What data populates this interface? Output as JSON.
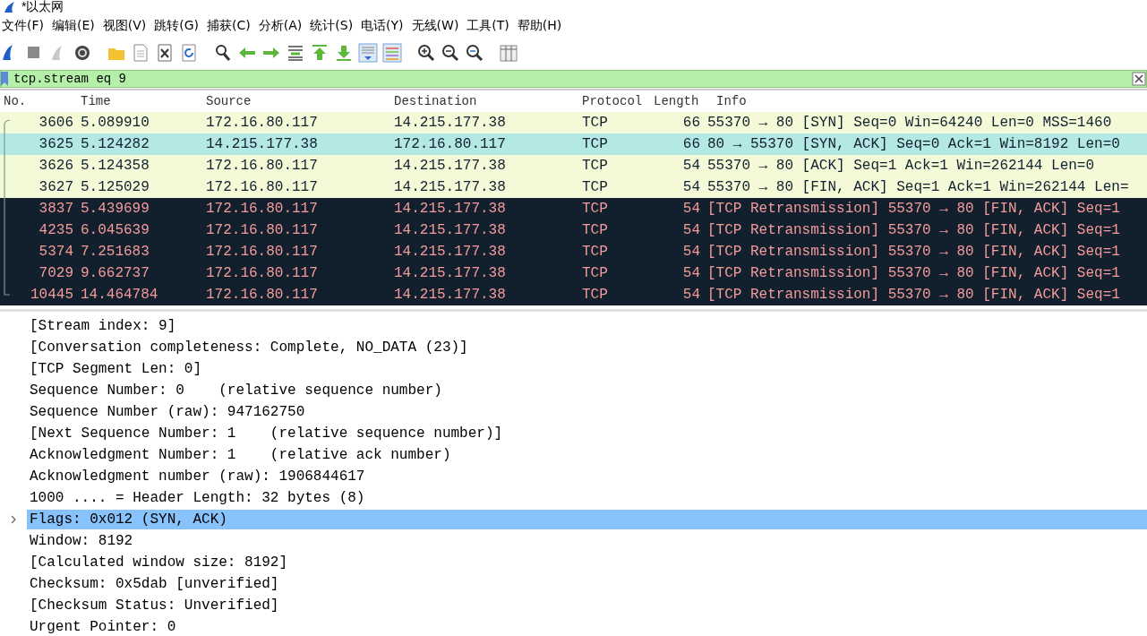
{
  "window": {
    "title": "*以太网"
  },
  "menu": [
    "文件(F)",
    "编辑(E)",
    "视图(V)",
    "跳转(G)",
    "捕获(C)",
    "分析(A)",
    "统计(S)",
    "电话(Y)",
    "无线(W)",
    "工具(T)",
    "帮助(H)"
  ],
  "filter": {
    "value": "tcp.stream eq 9"
  },
  "packet_list": {
    "columns": [
      "No.",
      "Time",
      "Source",
      "Destination",
      "Protocol",
      "Length",
      "Info"
    ],
    "rows": [
      {
        "no": "3606",
        "time": "5.089910",
        "source": "172.16.80.117",
        "destination": "14.215.177.38",
        "protocol": "TCP",
        "length": "66",
        "info": "55370 → 80 [SYN] Seq=0 Win=64240 Len=0 MSS=1460",
        "kind": "normal",
        "selected": false
      },
      {
        "no": "3625",
        "time": "5.124282",
        "source": "14.215.177.38",
        "destination": "172.16.80.117",
        "protocol": "TCP",
        "length": "66",
        "info": "80 → 55370 [SYN, ACK] Seq=0 Ack=1 Win=8192 Len=0",
        "kind": "normal",
        "selected": true
      },
      {
        "no": "3626",
        "time": "5.124358",
        "source": "172.16.80.117",
        "destination": "14.215.177.38",
        "protocol": "TCP",
        "length": "54",
        "info": "55370 → 80 [ACK] Seq=1 Ack=1 Win=262144 Len=0",
        "kind": "normal",
        "selected": false
      },
      {
        "no": "3627",
        "time": "5.125029",
        "source": "172.16.80.117",
        "destination": "14.215.177.38",
        "protocol": "TCP",
        "length": "54",
        "info": "55370 → 80 [FIN, ACK] Seq=1 Ack=1 Win=262144 Len=",
        "kind": "normal",
        "selected": false
      },
      {
        "no": "3837",
        "time": "5.439699",
        "source": "172.16.80.117",
        "destination": "14.215.177.38",
        "protocol": "TCP",
        "length": "54",
        "info": "[TCP Retransmission] 55370 → 80 [FIN, ACK] Seq=1",
        "kind": "bad",
        "selected": false
      },
      {
        "no": "4235",
        "time": "6.045639",
        "source": "172.16.80.117",
        "destination": "14.215.177.38",
        "protocol": "TCP",
        "length": "54",
        "info": "[TCP Retransmission] 55370 → 80 [FIN, ACK] Seq=1",
        "kind": "bad",
        "selected": false
      },
      {
        "no": "5374",
        "time": "7.251683",
        "source": "172.16.80.117",
        "destination": "14.215.177.38",
        "protocol": "TCP",
        "length": "54",
        "info": "[TCP Retransmission] 55370 → 80 [FIN, ACK] Seq=1",
        "kind": "bad",
        "selected": false
      },
      {
        "no": "7029",
        "time": "9.662737",
        "source": "172.16.80.117",
        "destination": "14.215.177.38",
        "protocol": "TCP",
        "length": "54",
        "info": "[TCP Retransmission] 55370 → 80 [FIN, ACK] Seq=1",
        "kind": "bad",
        "selected": false
      },
      {
        "no": "10445",
        "time": "14.464784",
        "source": "172.16.80.117",
        "destination": "14.215.177.38",
        "protocol": "TCP",
        "length": "54",
        "info": "[TCP Retransmission] 55370 → 80 [FIN, ACK] Seq=1",
        "kind": "bad",
        "selected": false
      }
    ]
  },
  "details": [
    {
      "text": "[Stream index: 9]",
      "expandable": false,
      "selected": false
    },
    {
      "text": "[Conversation completeness: Complete, NO_DATA (23)]",
      "expandable": false,
      "selected": false
    },
    {
      "text": "[TCP Segment Len: 0]",
      "expandable": false,
      "selected": false
    },
    {
      "text": "Sequence Number: 0    (relative sequence number)",
      "expandable": false,
      "selected": false
    },
    {
      "text": "Sequence Number (raw): 947162750",
      "expandable": false,
      "selected": false
    },
    {
      "text": "[Next Sequence Number: 1    (relative sequence number)]",
      "expandable": false,
      "selected": false
    },
    {
      "text": "Acknowledgment Number: 1    (relative ack number)",
      "expandable": false,
      "selected": false
    },
    {
      "text": "Acknowledgment number (raw): 1906844617",
      "expandable": false,
      "selected": false
    },
    {
      "text": "1000 .... = Header Length: 32 bytes (8)",
      "expandable": false,
      "selected": false
    },
    {
      "text": "Flags: 0x012 (SYN, ACK)",
      "expandable": true,
      "selected": true
    },
    {
      "text": "Window: 8192",
      "expandable": false,
      "selected": false
    },
    {
      "text": "[Calculated window size: 8192]",
      "expandable": false,
      "selected": false
    },
    {
      "text": "Checksum: 0x5dab [unverified]",
      "expandable": false,
      "selected": false
    },
    {
      "text": "[Checksum Status: Unverified]",
      "expandable": false,
      "selected": false
    },
    {
      "text": "Urgent Pointer: 0",
      "expandable": false,
      "selected": false
    }
  ]
}
